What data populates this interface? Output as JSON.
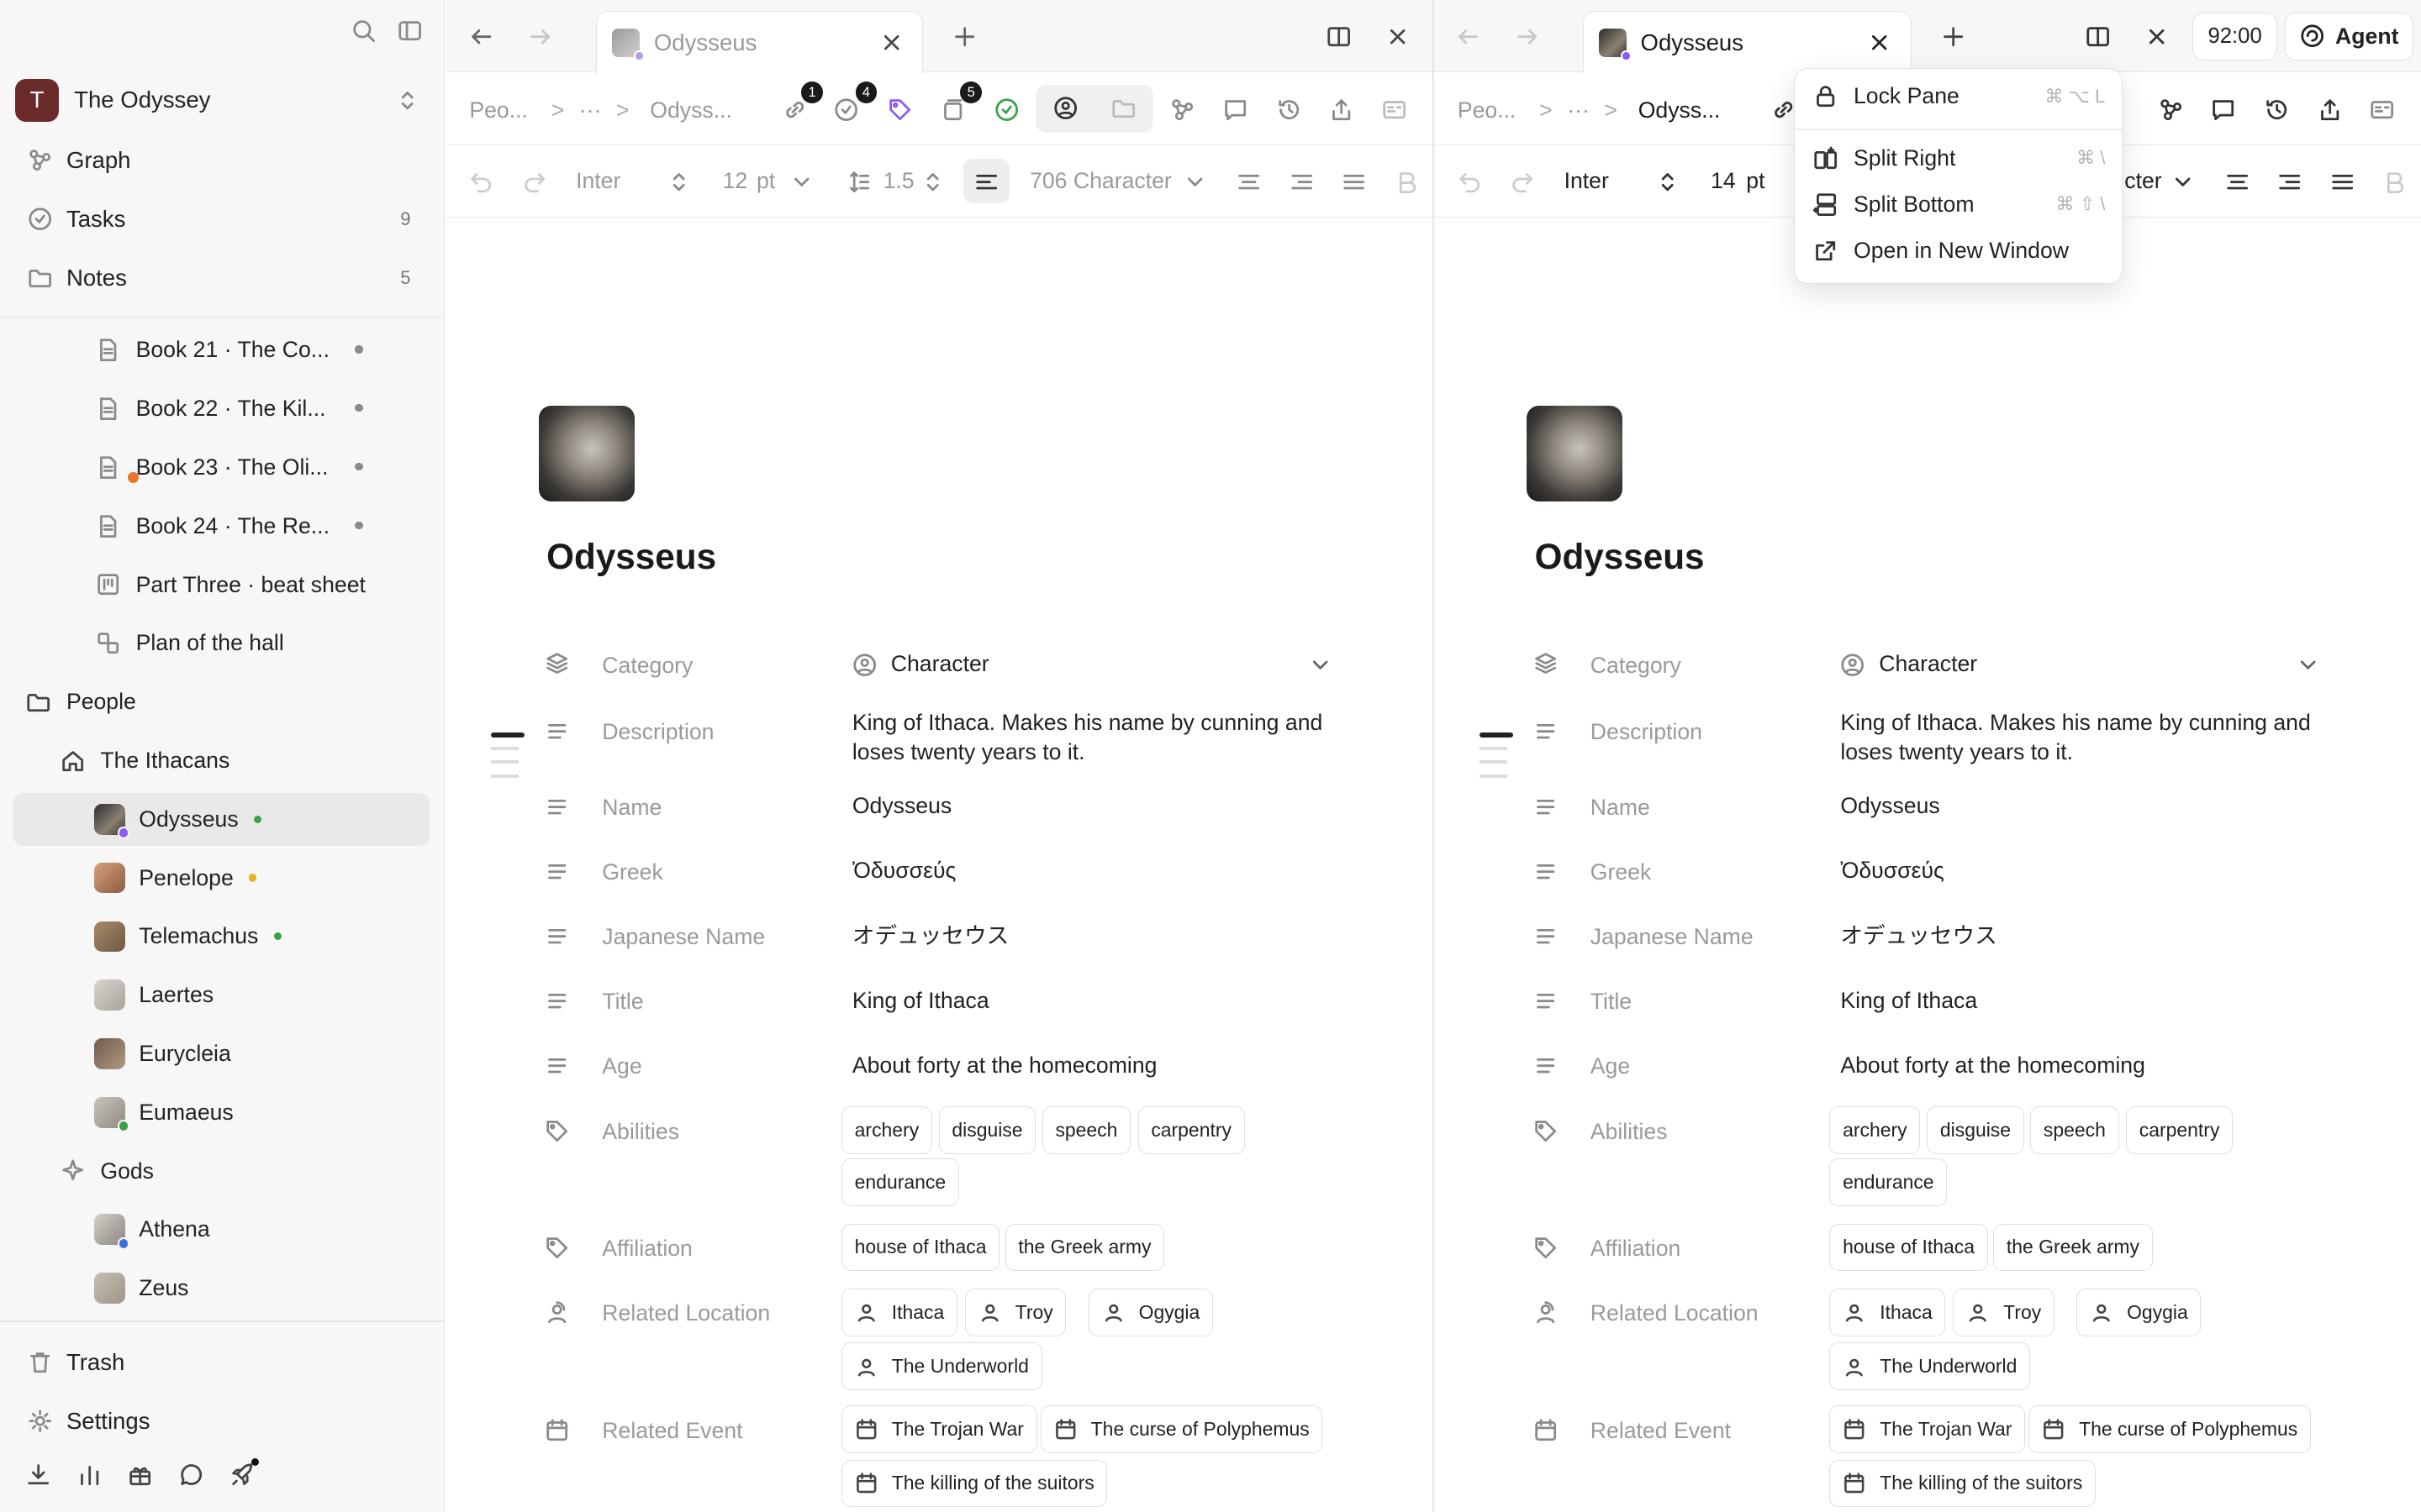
{
  "workspace": {
    "initial": "T",
    "name": "The Odyssey"
  },
  "nav": [
    {
      "label": "Graph"
    },
    {
      "label": "Tasks",
      "count": "9"
    },
    {
      "label": "Notes",
      "count": "5"
    }
  ],
  "tree": {
    "books": [
      "Book 21 · The Co...",
      "Book 22 · The Kil...",
      "Book 23 · The Oli...",
      "Book 24 · The Re..."
    ],
    "beat_sheet": "Part Three · beat sheet",
    "plan": "Plan of the hall",
    "people": "People",
    "ithacans": "The Ithacans",
    "members": [
      "Odysseus",
      "Penelope",
      "Telemachus",
      "Laertes",
      "Eurycleia",
      "Eumaeus"
    ],
    "gods": "Gods",
    "gods_members": [
      "Athena",
      "Zeus"
    ]
  },
  "sidebar_bottom": {
    "trash": "Trash",
    "settings": "Settings"
  },
  "left_pane": {
    "tab_title": "Odysseus",
    "breadcrumb": {
      "first": "Peo...",
      "ellipsis": "···",
      "current": "Odyss..."
    },
    "badges": [
      "1",
      "4",
      "5"
    ],
    "format": {
      "font": "Inter",
      "size": "12",
      "unit": "pt",
      "line_height": "1.5",
      "template": "706 Character"
    }
  },
  "right_pane": {
    "tab_title": "Odysseus",
    "time": "92:00",
    "agent": "Agent",
    "breadcrumb": {
      "first": "Peo...",
      "ellipsis": "···",
      "current": "Odyss..."
    },
    "format": {
      "font": "Inter",
      "size": "14",
      "unit": "pt",
      "template": "cter"
    }
  },
  "doc": {
    "title": "Odysseus",
    "category_label": "Category",
    "category_value": "Character",
    "description_label": "Description",
    "description_value": "King of Ithaca. Makes his name by cunning and loses twenty years to it.",
    "name_label": "Name",
    "name_value": "Odysseus",
    "greek_label": "Greek",
    "greek_value": "Ὀδυσσεύς",
    "japanese_label": "Japanese Name",
    "japanese_value": "オデュッセウス",
    "title_label": "Title",
    "title_value": "King of Ithaca",
    "age_label": "Age",
    "age_value": "About forty at the homecoming",
    "abilities_label": "Abilities",
    "abilities": [
      "archery",
      "disguise",
      "speech",
      "carpentry",
      "endurance"
    ],
    "affiliation_label": "Affiliation",
    "affiliation": [
      "house of Ithaca",
      "the Greek army"
    ],
    "location_label": "Related Location",
    "locations": [
      "Ithaca",
      "Troy",
      "Ogygia",
      "The Underworld"
    ],
    "event_label": "Related Event",
    "events": [
      "The Trojan War",
      "The curse of Polyphemus",
      "The killing of the suitors"
    ]
  },
  "menu": [
    {
      "label": "Lock Pane",
      "shortcut": "⌘ ⌥ L"
    },
    {
      "label": "Split Right",
      "shortcut": "⌘ \\"
    },
    {
      "label": "Split Bottom",
      "shortcut": "⌘ ⇧ \\"
    },
    {
      "label": "Open in New Window",
      "shortcut": ""
    }
  ],
  "colors": {
    "odysseus_dot": "#3aa14a",
    "penelope_dot": "#e6b422",
    "telemachus_dot": "#3aa14a",
    "accent_green": "#3aa14a"
  }
}
